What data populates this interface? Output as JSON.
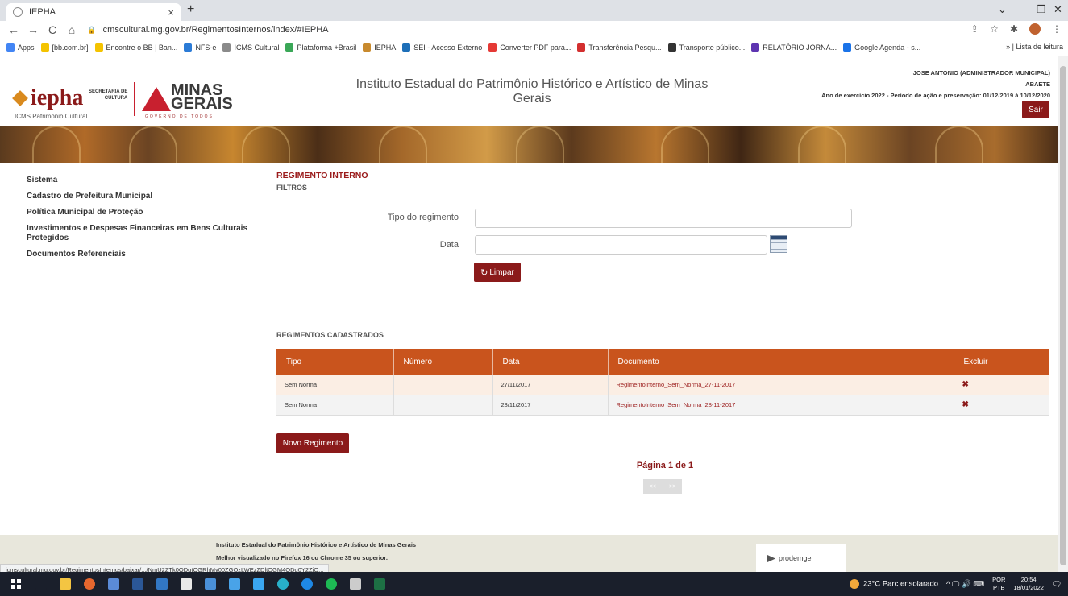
{
  "browser": {
    "tab_title": "IEPHA",
    "tab_close": "×",
    "new_tab": "+",
    "url": "icmscultural.mg.gov.br/RegimentosInternos/index/#IEPHA",
    "back": "←",
    "forward": "→",
    "reload": "C",
    "home": "⌂",
    "win_min": "—",
    "win_max": "❐",
    "win_close": "✕",
    "win_down": "⌄",
    "share": "⇪",
    "star": "☆",
    "ext": "✱",
    "menu": "⋮",
    "bookmarks": [
      {
        "label": "Apps",
        "color": "#4285f4"
      },
      {
        "label": "[bb.com.br]",
        "color": "#f4c300"
      },
      {
        "label": "Encontre o BB | Ban...",
        "color": "#f4c300"
      },
      {
        "label": "NFS-e",
        "color": "#2b7bd6"
      },
      {
        "label": "ICMS Cultural",
        "color": "#8a8a8a"
      },
      {
        "label": "Plataforma +Brasil",
        "color": "#3aa757"
      },
      {
        "label": "IEPHA",
        "color": "#c88a2e"
      },
      {
        "label": "SEI - Acesso Externo",
        "color": "#1d6fb8"
      },
      {
        "label": "Converter PDF para...",
        "color": "#e53935"
      },
      {
        "label": "Transferência Pesqu...",
        "color": "#d32f2f"
      },
      {
        "label": "Transporte público...",
        "color": "#333333"
      },
      {
        "label": "RELATÓRIO JORNA...",
        "color": "#5e35b1"
      },
      {
        "label": "Google Agenda - s...",
        "color": "#1a73e8"
      }
    ],
    "reading_list": "» | Lista de leitura",
    "status_url": "icmscultural.mg.gov.br/RegimentosInternos/baixar/.../NmU2ZTk0ODgtOGRhMy00ZGQzLWEzZDltOGM4ODg0Y2ZjO..."
  },
  "header": {
    "logo_iepha": "iepha",
    "logo_sub": "ICMS Patrimônio Cultural",
    "secretaria": "SECRETARIA DE\nCULTURA",
    "minas": "MINAS\nGERAIS",
    "governo": "GOVERNO DE TODOS",
    "site_title": "Instituto Estadual do Patrimônio Histórico e Artístico de Minas Gerais",
    "user_name": "JOSE ANTONIO (ADMINISTRADOR MUNICIPAL)",
    "municipio": "ABAETE",
    "exercicio": "Ano de exercício 2022 - Período de ação e preservação: 01/12/2019 à 10/12/2020",
    "sair": "Sair"
  },
  "sidebar": {
    "items": [
      {
        "label": "Sistema"
      },
      {
        "label": "Cadastro de Prefeitura Municipal"
      },
      {
        "label": "Política Municipal de Proteção"
      },
      {
        "label": "Investimentos e Despesas Financeiras em Bens Culturais Protegidos"
      },
      {
        "label": "Documentos Referenciais"
      }
    ]
  },
  "main": {
    "heading": "REGIMENTO INTERNO",
    "filters_heading": "FILTROS",
    "tipo_label": "Tipo do regimento",
    "tipo_value": "",
    "data_label": "Data",
    "data_value": "",
    "limpar": "Limpar",
    "registered_heading": "REGIMENTOS CADASTRADOS",
    "table": {
      "headers": [
        "Tipo",
        "Número",
        "Data",
        "Documento",
        "Excluir"
      ],
      "rows": [
        [
          "Sem Norma",
          "",
          "27/11/2017",
          "RegimentoInterno_Sem_Norma_27-11-2017",
          "✖"
        ],
        [
          "Sem Norma",
          "",
          "28/11/2017",
          "RegimentoInterno_Sem_Norma_28-11-2017",
          "✖"
        ]
      ]
    },
    "novo_regimento": "Novo Regimento",
    "pagination": "Página 1 de 1",
    "prev": "<<",
    "next": ">>"
  },
  "footer": {
    "line1": "Instituto Estadual do Patrimônio Histórico e Artístico de Minas Gerais",
    "line2": "Melhor visualizado no Firefox 16 ou Chrome 35 ou superior.",
    "prodemge": "prodemge"
  },
  "taskbar": {
    "apps": [
      {
        "name": "search",
        "color": "#1a1f2b"
      },
      {
        "name": "explorer",
        "color": "#f4c542"
      },
      {
        "name": "chrome",
        "color": "#e6672e"
      },
      {
        "name": "app-blue",
        "color": "#5b8bd6"
      },
      {
        "name": "word",
        "color": "#2b5797"
      },
      {
        "name": "edge-old",
        "color": "#3277c4"
      },
      {
        "name": "files",
        "color": "#e8e8e8"
      },
      {
        "name": "calendar",
        "color": "#4a90d9"
      },
      {
        "name": "paint",
        "color": "#49a3e8"
      },
      {
        "name": "store",
        "color": "#3aa7f2"
      },
      {
        "name": "edge",
        "color": "#28b0c9"
      },
      {
        "name": "ie",
        "color": "#1e88e5"
      },
      {
        "name": "spotify",
        "color": "#1db954"
      },
      {
        "name": "settings",
        "color": "#cccccc"
      },
      {
        "name": "excel",
        "color": "#1d7044"
      }
    ],
    "weather": "23°C  Parc ensolarado",
    "tray_icons": "^ 🖵 🔊 ⌨",
    "lang": "POR\nPTB",
    "time": "20:54",
    "date": "18/01/2022",
    "notif": "🗨"
  }
}
